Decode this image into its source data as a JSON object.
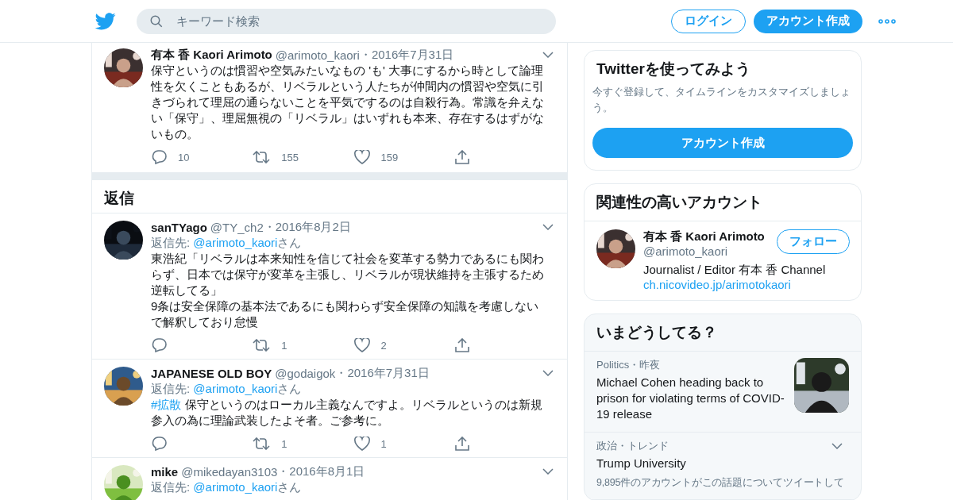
{
  "header": {
    "search": {
      "placeholder": "キーワード検索"
    },
    "login": "ログイン",
    "signup": "アカウント作成"
  },
  "main_tweet": {
    "name": "有本 香 Kaori Arimoto",
    "handle": "@arimoto_kaori",
    "date": "・2016年7月31日",
    "text": "保守というのは慣習や空気みたいなもの 'も' 大事にするから時として論理性を欠くこともあるが、リベラルという人たちが仲間内の慣習や空気に引きづられて理屈の通らないことを平気でするのは自殺行為。常識を弁えない「保守」、理屈無視の「リベラル」はいずれも本来、存在するはずがないもの。",
    "replies": "10",
    "retweets": "155",
    "likes": "159"
  },
  "replies_heading": "返信",
  "replies": [
    {
      "name": "sanTYago",
      "handle": "@TY_ch2",
      "date": "・2016年8月2日",
      "reply_prefix": "返信先: ",
      "reply_to": "@arimoto_kaori",
      "reply_suffix": "さん",
      "text": "東浩紀「リベラルは本来知性を信じて社会を変革する勢力であるにも関わらず、日本では保守が変革を主張し、リベラルが現状維持を主張するため逆転してる」\n9条は安全保障の基本法であるにも関わらず安全保障の知識を考慮しないで解釈しており怠慢",
      "retweets": "1",
      "likes": "2"
    },
    {
      "name": "JAPANESE OLD BOY",
      "handle": "@godaigok",
      "date": "・2016年7月31日",
      "reply_prefix": "返信先: ",
      "reply_to": "@arimoto_kaori",
      "reply_suffix": "さん",
      "hashtag": "#拡散",
      "text": "保守というのはローカル主義なんですよ。リベラルというのは新規参入の為に理論武装したよそ者。ご参考に。",
      "retweets": "1",
      "likes": "1"
    },
    {
      "name": "mike",
      "handle": "@mikedayan3103",
      "date": "・2016年8月1日",
      "reply_prefix": "返信先: ",
      "reply_to": "@arimoto_kaori",
      "reply_suffix": "さん"
    }
  ],
  "signup_card": {
    "title": "Twitterを使ってみよう",
    "text": "今すぐ登録して、タイムラインをカスタマイズしましょう。",
    "button": "アカウント作成"
  },
  "related_card": {
    "title": "関連性の高いアカウント",
    "name": "有本 香 Kaori Arimoto",
    "handle": "@arimoto_kaori",
    "follow": "フォロー",
    "bio": "Journalist / Editor 有本 香 Channel",
    "link": "ch.nicovideo.jp/arimotokaori"
  },
  "trends": {
    "title": "いまどうしてる？",
    "items": [
      {
        "kind": "news",
        "context": "Politics・昨夜",
        "title": "Michael Cohen heading back to prison for violating terms of COVID-19 release"
      },
      {
        "kind": "trend",
        "context": "政治・トレンド",
        "title": "Trump University",
        "description": "9,895件のアカウントがこの話題についてツイートして"
      }
    ]
  }
}
